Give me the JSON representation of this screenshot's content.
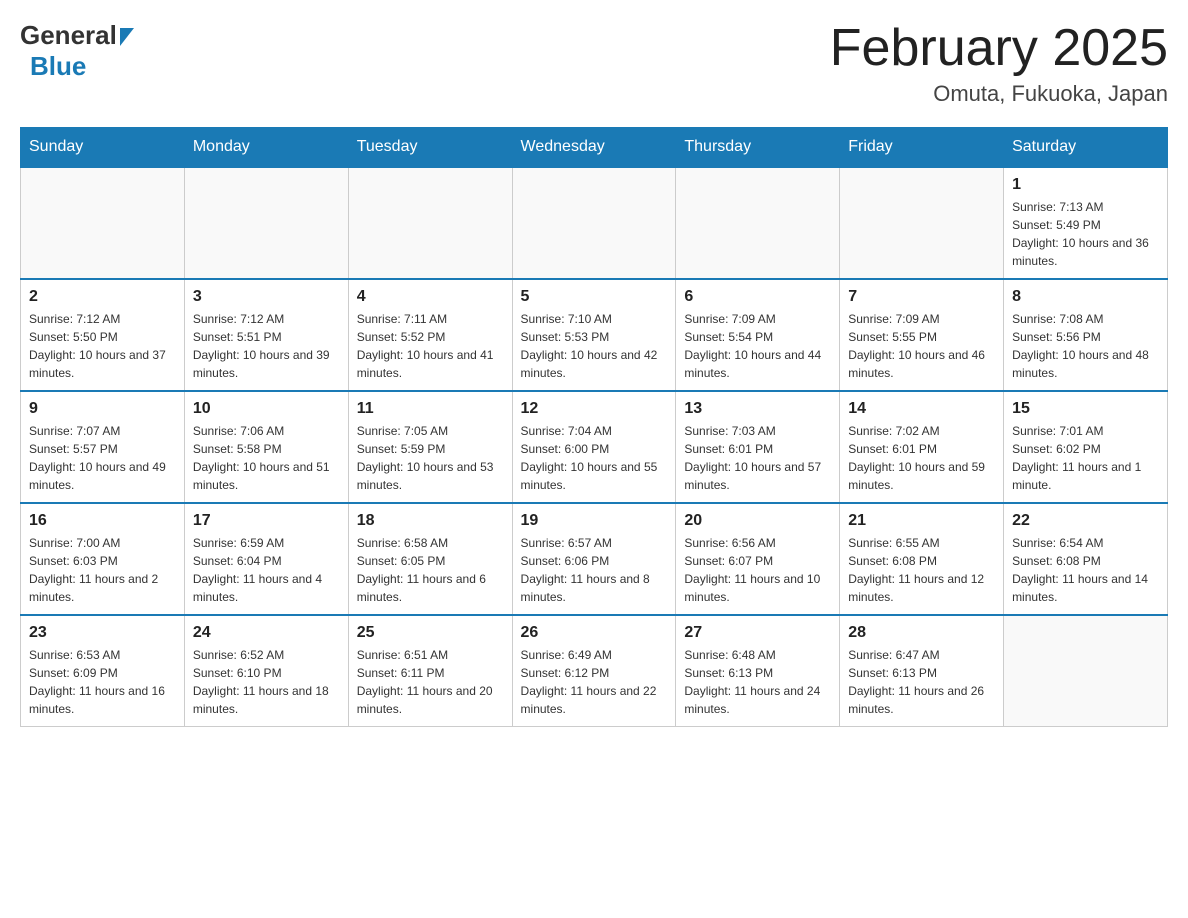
{
  "header": {
    "logo_general": "General",
    "logo_blue": "Blue",
    "month_title": "February 2025",
    "location": "Omuta, Fukuoka, Japan"
  },
  "days_of_week": [
    "Sunday",
    "Monday",
    "Tuesday",
    "Wednesday",
    "Thursday",
    "Friday",
    "Saturday"
  ],
  "weeks": [
    [
      {
        "day": "",
        "sunrise": "",
        "sunset": "",
        "daylight": ""
      },
      {
        "day": "",
        "sunrise": "",
        "sunset": "",
        "daylight": ""
      },
      {
        "day": "",
        "sunrise": "",
        "sunset": "",
        "daylight": ""
      },
      {
        "day": "",
        "sunrise": "",
        "sunset": "",
        "daylight": ""
      },
      {
        "day": "",
        "sunrise": "",
        "sunset": "",
        "daylight": ""
      },
      {
        "day": "",
        "sunrise": "",
        "sunset": "",
        "daylight": ""
      },
      {
        "day": "1",
        "sunrise": "Sunrise: 7:13 AM",
        "sunset": "Sunset: 5:49 PM",
        "daylight": "Daylight: 10 hours and 36 minutes."
      }
    ],
    [
      {
        "day": "2",
        "sunrise": "Sunrise: 7:12 AM",
        "sunset": "Sunset: 5:50 PM",
        "daylight": "Daylight: 10 hours and 37 minutes."
      },
      {
        "day": "3",
        "sunrise": "Sunrise: 7:12 AM",
        "sunset": "Sunset: 5:51 PM",
        "daylight": "Daylight: 10 hours and 39 minutes."
      },
      {
        "day": "4",
        "sunrise": "Sunrise: 7:11 AM",
        "sunset": "Sunset: 5:52 PM",
        "daylight": "Daylight: 10 hours and 41 minutes."
      },
      {
        "day": "5",
        "sunrise": "Sunrise: 7:10 AM",
        "sunset": "Sunset: 5:53 PM",
        "daylight": "Daylight: 10 hours and 42 minutes."
      },
      {
        "day": "6",
        "sunrise": "Sunrise: 7:09 AM",
        "sunset": "Sunset: 5:54 PM",
        "daylight": "Daylight: 10 hours and 44 minutes."
      },
      {
        "day": "7",
        "sunrise": "Sunrise: 7:09 AM",
        "sunset": "Sunset: 5:55 PM",
        "daylight": "Daylight: 10 hours and 46 minutes."
      },
      {
        "day": "8",
        "sunrise": "Sunrise: 7:08 AM",
        "sunset": "Sunset: 5:56 PM",
        "daylight": "Daylight: 10 hours and 48 minutes."
      }
    ],
    [
      {
        "day": "9",
        "sunrise": "Sunrise: 7:07 AM",
        "sunset": "Sunset: 5:57 PM",
        "daylight": "Daylight: 10 hours and 49 minutes."
      },
      {
        "day": "10",
        "sunrise": "Sunrise: 7:06 AM",
        "sunset": "Sunset: 5:58 PM",
        "daylight": "Daylight: 10 hours and 51 minutes."
      },
      {
        "day": "11",
        "sunrise": "Sunrise: 7:05 AM",
        "sunset": "Sunset: 5:59 PM",
        "daylight": "Daylight: 10 hours and 53 minutes."
      },
      {
        "day": "12",
        "sunrise": "Sunrise: 7:04 AM",
        "sunset": "Sunset: 6:00 PM",
        "daylight": "Daylight: 10 hours and 55 minutes."
      },
      {
        "day": "13",
        "sunrise": "Sunrise: 7:03 AM",
        "sunset": "Sunset: 6:01 PM",
        "daylight": "Daylight: 10 hours and 57 minutes."
      },
      {
        "day": "14",
        "sunrise": "Sunrise: 7:02 AM",
        "sunset": "Sunset: 6:01 PM",
        "daylight": "Daylight: 10 hours and 59 minutes."
      },
      {
        "day": "15",
        "sunrise": "Sunrise: 7:01 AM",
        "sunset": "Sunset: 6:02 PM",
        "daylight": "Daylight: 11 hours and 1 minute."
      }
    ],
    [
      {
        "day": "16",
        "sunrise": "Sunrise: 7:00 AM",
        "sunset": "Sunset: 6:03 PM",
        "daylight": "Daylight: 11 hours and 2 minutes."
      },
      {
        "day": "17",
        "sunrise": "Sunrise: 6:59 AM",
        "sunset": "Sunset: 6:04 PM",
        "daylight": "Daylight: 11 hours and 4 minutes."
      },
      {
        "day": "18",
        "sunrise": "Sunrise: 6:58 AM",
        "sunset": "Sunset: 6:05 PM",
        "daylight": "Daylight: 11 hours and 6 minutes."
      },
      {
        "day": "19",
        "sunrise": "Sunrise: 6:57 AM",
        "sunset": "Sunset: 6:06 PM",
        "daylight": "Daylight: 11 hours and 8 minutes."
      },
      {
        "day": "20",
        "sunrise": "Sunrise: 6:56 AM",
        "sunset": "Sunset: 6:07 PM",
        "daylight": "Daylight: 11 hours and 10 minutes."
      },
      {
        "day": "21",
        "sunrise": "Sunrise: 6:55 AM",
        "sunset": "Sunset: 6:08 PM",
        "daylight": "Daylight: 11 hours and 12 minutes."
      },
      {
        "day": "22",
        "sunrise": "Sunrise: 6:54 AM",
        "sunset": "Sunset: 6:08 PM",
        "daylight": "Daylight: 11 hours and 14 minutes."
      }
    ],
    [
      {
        "day": "23",
        "sunrise": "Sunrise: 6:53 AM",
        "sunset": "Sunset: 6:09 PM",
        "daylight": "Daylight: 11 hours and 16 minutes."
      },
      {
        "day": "24",
        "sunrise": "Sunrise: 6:52 AM",
        "sunset": "Sunset: 6:10 PM",
        "daylight": "Daylight: 11 hours and 18 minutes."
      },
      {
        "day": "25",
        "sunrise": "Sunrise: 6:51 AM",
        "sunset": "Sunset: 6:11 PM",
        "daylight": "Daylight: 11 hours and 20 minutes."
      },
      {
        "day": "26",
        "sunrise": "Sunrise: 6:49 AM",
        "sunset": "Sunset: 6:12 PM",
        "daylight": "Daylight: 11 hours and 22 minutes."
      },
      {
        "day": "27",
        "sunrise": "Sunrise: 6:48 AM",
        "sunset": "Sunset: 6:13 PM",
        "daylight": "Daylight: 11 hours and 24 minutes."
      },
      {
        "day": "28",
        "sunrise": "Sunrise: 6:47 AM",
        "sunset": "Sunset: 6:13 PM",
        "daylight": "Daylight: 11 hours and 26 minutes."
      },
      {
        "day": "",
        "sunrise": "",
        "sunset": "",
        "daylight": ""
      }
    ]
  ]
}
